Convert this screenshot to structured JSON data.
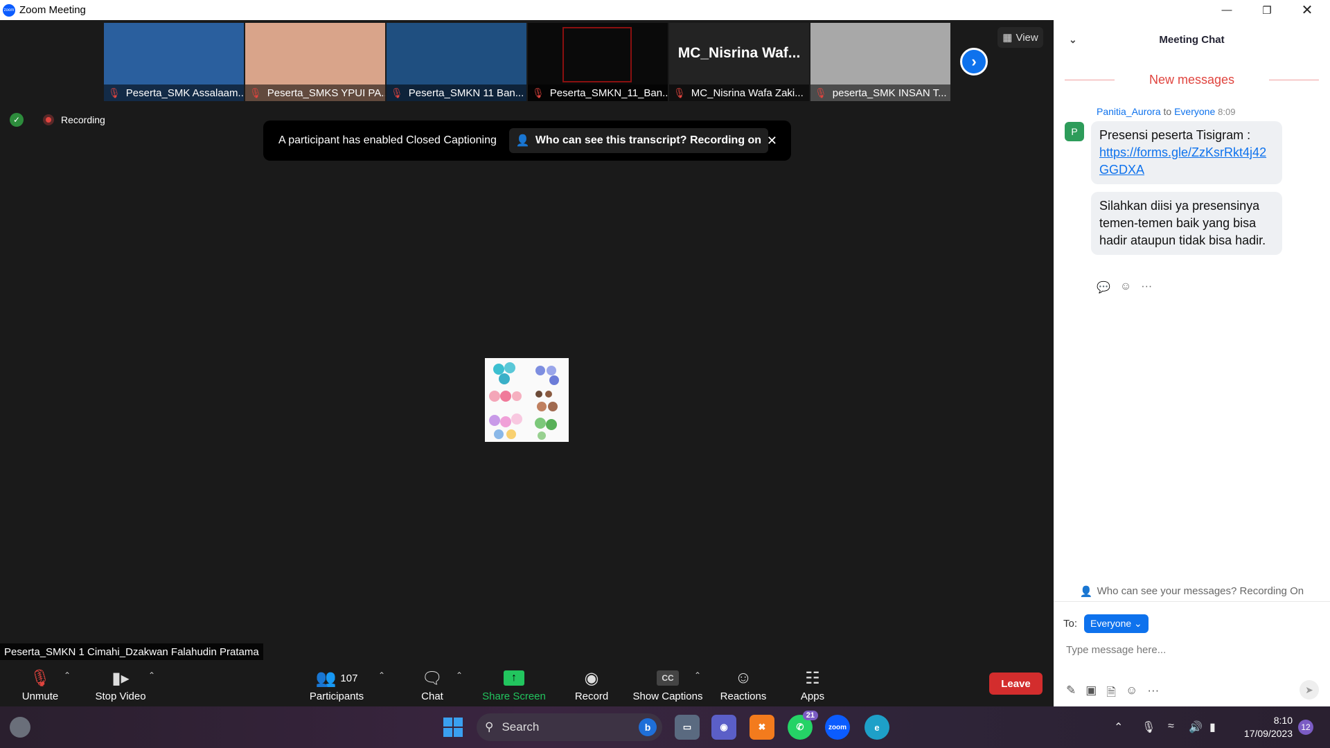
{
  "window": {
    "title": "Zoom Meeting",
    "app_icon": "zoom"
  },
  "stage": {
    "view_label": "View",
    "recording_label": "Recording",
    "thumbnails": [
      {
        "name": "Peserta_SMK Assalaam...",
        "bg": "#2a5f9e",
        "big_name": "",
        "muted": true
      },
      {
        "name": "Peserta_SMKS YPUI PA...",
        "bg": "#d9a48a",
        "big_name": "",
        "muted": true
      },
      {
        "name": "Peserta_SMKN 11 Ban...",
        "bg": "#1f4f80",
        "big_name": "",
        "muted": true
      },
      {
        "name": "Peserta_SMKN_11_Ban...",
        "bg": "#0a0a0a",
        "big_name": "",
        "muted": true
      },
      {
        "name": "MC_Nisrina Wafa Zaki...",
        "bg": "#232323",
        "big_name": "MC_Nisrina   Waf...",
        "muted": true
      },
      {
        "name": "peserta_SMK INSAN T...",
        "bg": "#a8a8a8",
        "big_name": "",
        "muted": true
      }
    ],
    "cc_banner": {
      "text": "A participant has enabled Closed Captioning",
      "who": "Who can see this transcript? Recording on"
    },
    "speaker_label": "Peserta_SMKN 1 Cimahi_Dzakwan Falahudin Pratama"
  },
  "toolbar": {
    "unmute": "Unmute",
    "stop_video": "Stop Video",
    "participants": "Participants",
    "participants_count": "107",
    "chat": "Chat",
    "share_screen": "Share Screen",
    "record": "Record",
    "show_captions": "Show Captions",
    "cc_icon_text": "CC",
    "reactions": "Reactions",
    "apps": "Apps",
    "leave": "Leave"
  },
  "chat": {
    "title": "Meeting Chat",
    "new_messages": "New messages",
    "message": {
      "sender": "Panitia_Aurora",
      "to_word": "to",
      "recipient": "Everyone",
      "time": "8:09",
      "avatar_letter": "P",
      "avatar_color": "#2d9c5a",
      "text1_prefix": "Presensi peserta Tisigram :",
      "link": "https://forms.gle/ZzKsrRkt4j42GGDXA",
      "text2": "Silahkan diisi ya presensinya temen-temen baik yang bisa hadir ataupun tidak bisa hadir."
    },
    "privacy": "Who can see your messages? Recording On",
    "to_label": "To:",
    "to_value": "Everyone",
    "input_placeholder": "Type message here..."
  },
  "taskbar": {
    "search_label": "Search",
    "bing_letter": "b",
    "zoom_label": "zoom",
    "whatsapp_badge": "21",
    "time": "8:10",
    "date": "17/09/2023",
    "notif_count": "12"
  },
  "colors": {
    "accent": "#0e72ed",
    "leave": "#d32d2d",
    "share": "#22c55e",
    "new_messages": "#e0443e"
  }
}
